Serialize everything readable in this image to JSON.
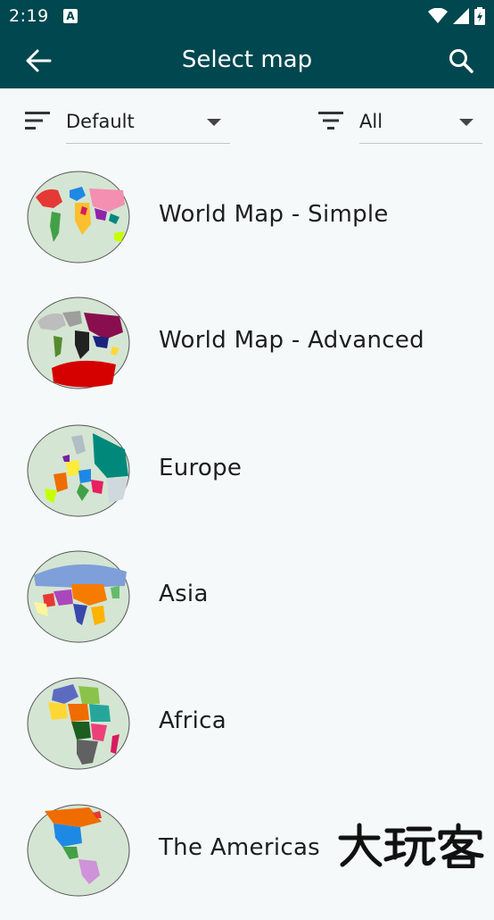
{
  "status_bar": {
    "time": "2:19",
    "notification_icon": "a-icon",
    "system_icons": [
      "wifi-icon",
      "signal-icon",
      "battery-icon"
    ]
  },
  "app_bar": {
    "title": "Select map",
    "back_icon": "arrow-left-icon",
    "search_icon": "search-icon"
  },
  "filters": {
    "sort": {
      "icon": "sort-icon",
      "value": "Default"
    },
    "category": {
      "icon": "filter-icon",
      "value": "All"
    }
  },
  "maps": [
    {
      "label": "World Map - Simple",
      "thumb": "world-simple-thumbnail"
    },
    {
      "label": "World Map - Advanced",
      "thumb": "world-advanced-thumbnail"
    },
    {
      "label": "Europe",
      "thumb": "europe-thumbnail"
    },
    {
      "label": "Asia",
      "thumb": "asia-thumbnail"
    },
    {
      "label": "Africa",
      "thumb": "africa-thumbnail"
    },
    {
      "label": "The Americas",
      "thumb": "americas-thumbnail"
    }
  ],
  "watermark": {
    "text": "大玩客"
  },
  "colors": {
    "app_bar": "#00474f",
    "background": "#f5f9f9",
    "thumb_bg": "#d4e5d3"
  }
}
